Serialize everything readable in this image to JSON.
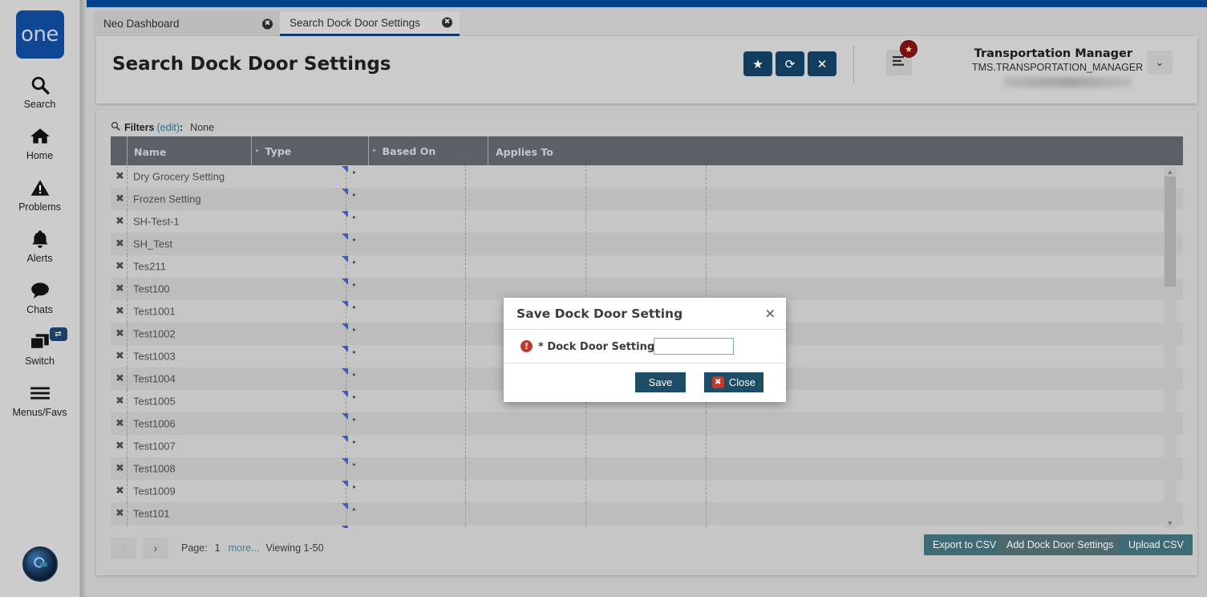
{
  "rail": {
    "logo_text": "one",
    "items": [
      {
        "label": "Search",
        "icon": "search-icon"
      },
      {
        "label": "Home",
        "icon": "home-icon"
      },
      {
        "label": "Problems",
        "icon": "warning-triangle-icon"
      },
      {
        "label": "Alerts",
        "icon": "bell-icon"
      },
      {
        "label": "Chats",
        "icon": "chat-bubble-icon"
      },
      {
        "label": "Switch",
        "icon": "windows-stack-icon",
        "badge": "⇄"
      },
      {
        "label": "Menus/Favs",
        "icon": "hamburger-icon"
      }
    ]
  },
  "tabs": [
    {
      "label": "Neo Dashboard",
      "active": false,
      "close": "✖"
    },
    {
      "label": "Search Dock Door Settings",
      "active": true,
      "close": "✖"
    }
  ],
  "header": {
    "title": "Search Dock Door Settings",
    "buttons": [
      {
        "name": "favorite-button",
        "glyph": "★"
      },
      {
        "name": "refresh-button",
        "glyph": "⟳"
      },
      {
        "name": "close-button",
        "glyph": "✕"
      }
    ],
    "menu_icon": "hamburger-menu-icon",
    "menu_badge_glyph": "★",
    "user_role": "Transportation Manager",
    "user_id": "TMS.TRANSPORTATION_MANAGER",
    "caret": "⌄"
  },
  "filters": {
    "icon": "search-icon",
    "label": "Filters",
    "edit_link": "(edit)",
    "colon": ":",
    "value": "None"
  },
  "grid": {
    "columns": [
      {
        "label": "Name",
        "sortable": false
      },
      {
        "label": "Type",
        "sortable": true
      },
      {
        "label": "Based On",
        "sortable": true
      },
      {
        "label": "Applies To",
        "sortable": false
      },
      {
        "label": "",
        "sortable": false
      }
    ],
    "delete_glyph": "✖",
    "rows": [
      {
        "name": "Dry Grocery Setting",
        "type": "",
        "based_on": "",
        "applies_to": ""
      },
      {
        "name": "Frozen Setting",
        "type": "",
        "based_on": "",
        "applies_to": ""
      },
      {
        "name": "SH-Test-1",
        "type": "",
        "based_on": "",
        "applies_to": ""
      },
      {
        "name": "SH_Test",
        "type": "",
        "based_on": "",
        "applies_to": ""
      },
      {
        "name": "Tes211",
        "type": "",
        "based_on": "",
        "applies_to": ""
      },
      {
        "name": "Test100",
        "type": "",
        "based_on": "",
        "applies_to": ""
      },
      {
        "name": "Test1001",
        "type": "",
        "based_on": "",
        "applies_to": ""
      },
      {
        "name": "Test1002",
        "type": "",
        "based_on": "",
        "applies_to": ""
      },
      {
        "name": "Test1003",
        "type": "",
        "based_on": "",
        "applies_to": ""
      },
      {
        "name": "Test1004",
        "type": "",
        "based_on": "",
        "applies_to": ""
      },
      {
        "name": "Test1005",
        "type": "",
        "based_on": "",
        "applies_to": ""
      },
      {
        "name": "Test1006",
        "type": "",
        "based_on": "",
        "applies_to": ""
      },
      {
        "name": "Test1007",
        "type": "",
        "based_on": "",
        "applies_to": ""
      },
      {
        "name": "Test1008",
        "type": "",
        "based_on": "",
        "applies_to": ""
      },
      {
        "name": "Test1009",
        "type": "",
        "based_on": "",
        "applies_to": ""
      },
      {
        "name": "Test101",
        "type": "",
        "based_on": "",
        "applies_to": ""
      },
      {
        "name": "",
        "type": "",
        "based_on": "",
        "applies_to": ""
      }
    ]
  },
  "pager": {
    "prev_glyph": "‹",
    "next_glyph": "›",
    "page_label": "Page:",
    "page_number": "1",
    "more_link": "more...",
    "viewing": "Viewing 1-50"
  },
  "footer_buttons": {
    "export": "Export to CSV",
    "add": "Add Dock Door Settings",
    "upload": "Upload CSV"
  },
  "modal": {
    "title": "Save Dock Door Setting",
    "close_glyph": "✕",
    "required_glyph": "!",
    "field_label": "* Dock Door Setting Name:",
    "field_value": "",
    "field_placeholder": "",
    "save_label": "Save",
    "close_label": "Close",
    "close_badge_glyph": "✖"
  },
  "colors": {
    "brand_blue": "#104794",
    "top_strip": "#004289",
    "grid_header": "#5b5f66",
    "teal_button": "#3e6b74",
    "modal_button": "#1c4c66",
    "required_red": "#c0392b",
    "link_blue": "#2d6b8c",
    "row_corner_blue": "#3b5fc0"
  }
}
